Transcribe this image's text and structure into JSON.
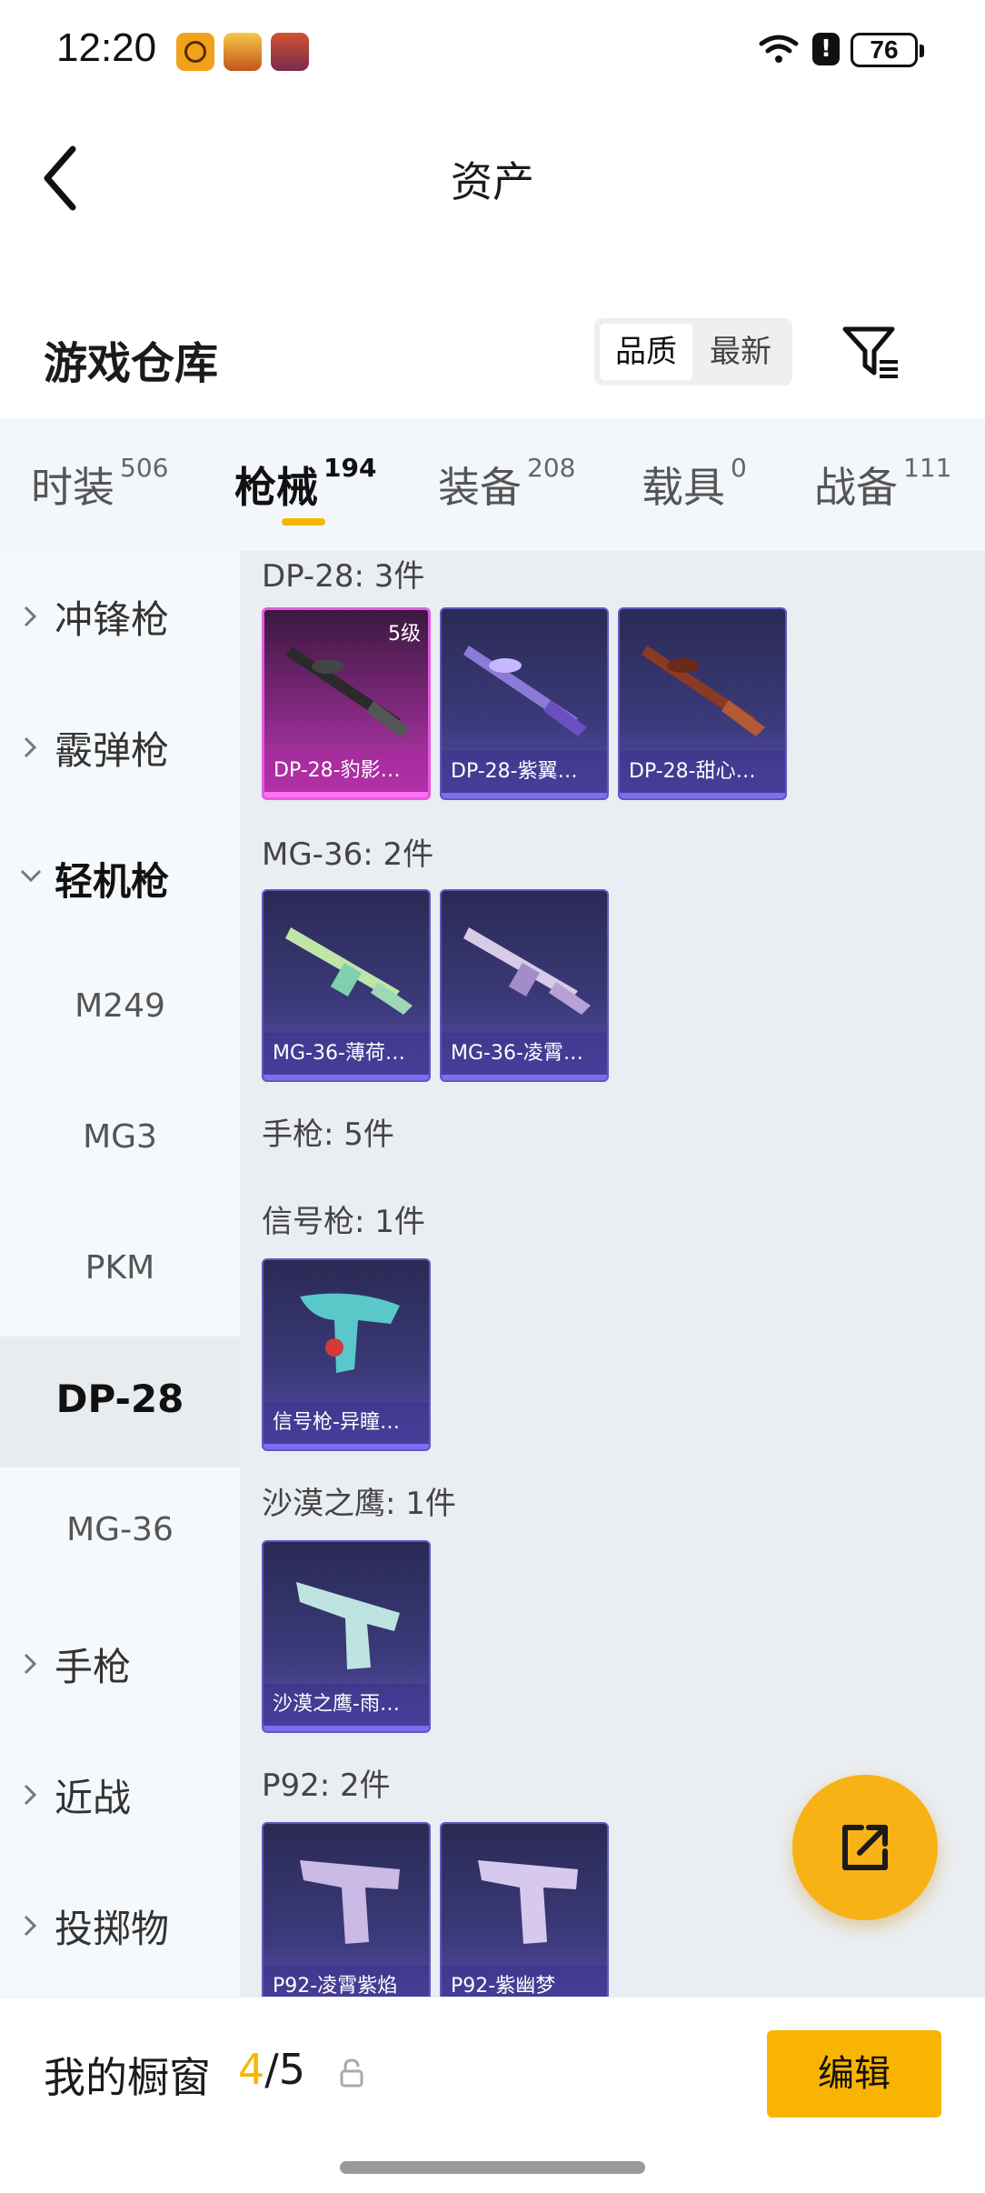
{
  "status_bar": {
    "time": "12:20",
    "battery": "76",
    "icons": [
      "app-icon-1",
      "app-icon-2",
      "app-icon-3",
      "wifi-icon",
      "alert-icon",
      "battery-icon"
    ]
  },
  "header": {
    "title": "资产",
    "back_icon": "chevron-left-icon"
  },
  "warehouse": {
    "title": "游戏仓库",
    "sort_options": [
      "品质",
      "最新"
    ],
    "selected_sort": "品质",
    "filter_icon": "filter-icon"
  },
  "tabs": [
    {
      "label": "时装",
      "count": "506"
    },
    {
      "label": "枪械",
      "count": "194"
    },
    {
      "label": "装备",
      "count": "208"
    },
    {
      "label": "载具",
      "count": "0"
    },
    {
      "label": "战备",
      "count": "111"
    }
  ],
  "active_tab": "枪械",
  "sidebar": [
    {
      "label": "冲锋枪"
    },
    {
      "label": "霰弹枪"
    },
    {
      "label": "轻机枪"
    },
    {
      "label": "M249"
    },
    {
      "label": "MG3"
    },
    {
      "label": "PKM"
    },
    {
      "label": "DP-28"
    },
    {
      "label": "MG-36"
    },
    {
      "label": "手枪"
    },
    {
      "label": "近战"
    },
    {
      "label": "投掷物"
    }
  ],
  "groups": [
    {
      "title": "DP-28: 3件",
      "items": [
        {
          "name": "DP-28-豹影…",
          "level": "5级"
        },
        {
          "name": "DP-28-紫翼…"
        },
        {
          "name": "DP-28-甜心…"
        }
      ]
    },
    {
      "title": "MG-36: 2件",
      "items": [
        {
          "name": "MG-36-薄荷…"
        },
        {
          "name": "MG-36-凌霄…"
        }
      ]
    },
    {
      "title": "手枪: 5件"
    },
    {
      "title": "信号枪: 1件",
      "items": [
        {
          "name": "信号枪-异瞳…"
        }
      ]
    },
    {
      "title": "沙漠之鹰: 1件",
      "items": [
        {
          "name": "沙漠之鹰-雨…"
        }
      ]
    },
    {
      "title": "P92: 2件",
      "items": [
        {
          "name": "P92-凌霄紫焰"
        },
        {
          "name": "P92-紫幽梦"
        }
      ]
    }
  ],
  "fab_icon": "share-icon",
  "bottom": {
    "label": "我的橱窗",
    "count_current": "4",
    "count_total": "/5",
    "lock_icon": "lock-icon",
    "edit_label": "编辑"
  },
  "colors": {
    "accent": "#f5b700",
    "card_epic": "#3b3a7a",
    "card_legendary": "#c13cb4"
  }
}
